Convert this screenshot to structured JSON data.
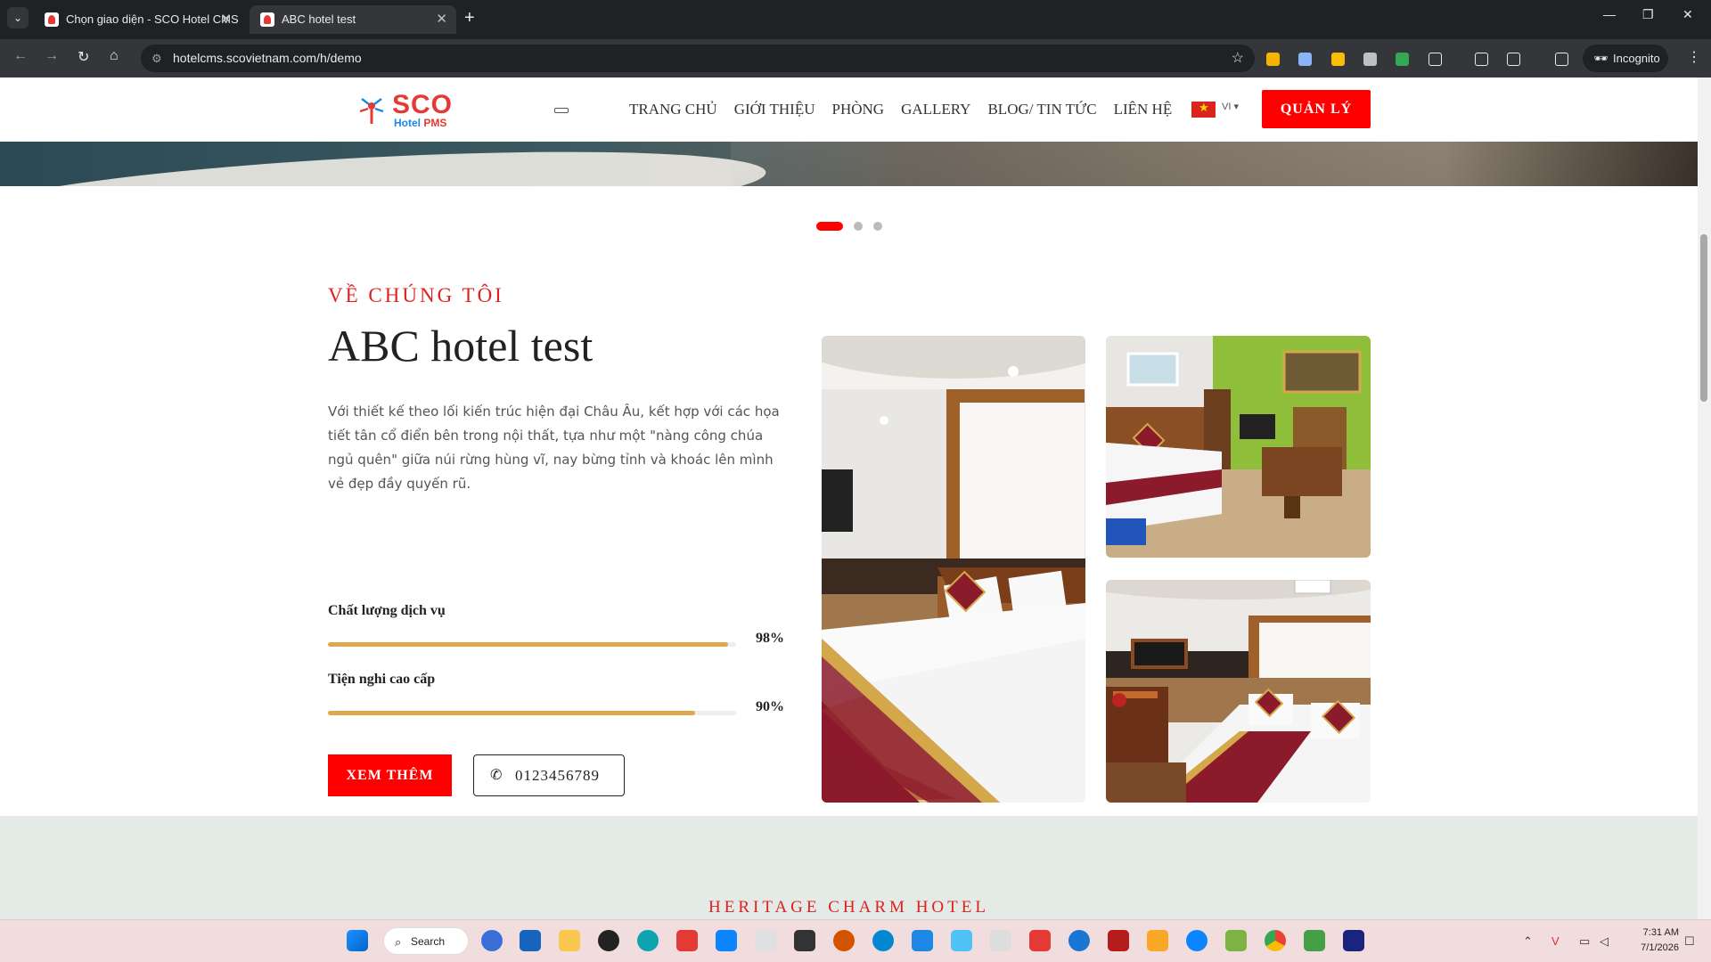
{
  "browser": {
    "tabs": [
      {
        "title": "Chọn giao diện - SCO Hotel CMS",
        "active": false
      },
      {
        "title": "ABC hotel test",
        "active": true
      }
    ],
    "url": "hotelcms.scovietnam.com/h/demo",
    "incognito_label": "Incognito"
  },
  "header": {
    "logo_text": "SCO",
    "logo_sub_a": "Hotel",
    "logo_sub_b": "PMS",
    "menu": [
      "TRANG CHỦ",
      "GIỚI THIỆU",
      "PHÒNG",
      "GALLERY",
      "BLOG/ TIN TỨC",
      "LIÊN HỆ"
    ],
    "lang": "VI",
    "cta": "QUẢN LÝ"
  },
  "slider": {
    "dots": 3,
    "active": 0
  },
  "about": {
    "eyebrow": "VỀ CHÚNG TÔI",
    "title": "ABC hotel test",
    "description": "Với thiết kế theo lối kiến trúc hiện đại Châu Âu, kết hợp với các họa tiết tân cổ điển bên trong nội thất, tựa như một \"nàng công chúa ngủ quên\" giữa núi rừng hùng vĩ, nay bừng tỉnh và khoác lên mình vẻ đẹp đầy quyến rũ.",
    "skills": [
      {
        "label": "Chất lượng dịch vụ",
        "percent_text": "98%",
        "value": 0.98
      },
      {
        "label": "Tiện nghi cao cấp",
        "percent_text": "90%",
        "value": 0.9
      }
    ],
    "more_button": "XEM THÊM",
    "phone": "0123456789"
  },
  "heritage": {
    "heading": "HERITAGE CHARM HOTEL"
  },
  "taskbar": {
    "search_label": "Search",
    "time": "7:31 AM",
    "date": "7/1/2026"
  },
  "colors": {
    "accent": "#ff0000",
    "gold": "#e0a84e",
    "heritage_bg": "#e4ebe7"
  }
}
